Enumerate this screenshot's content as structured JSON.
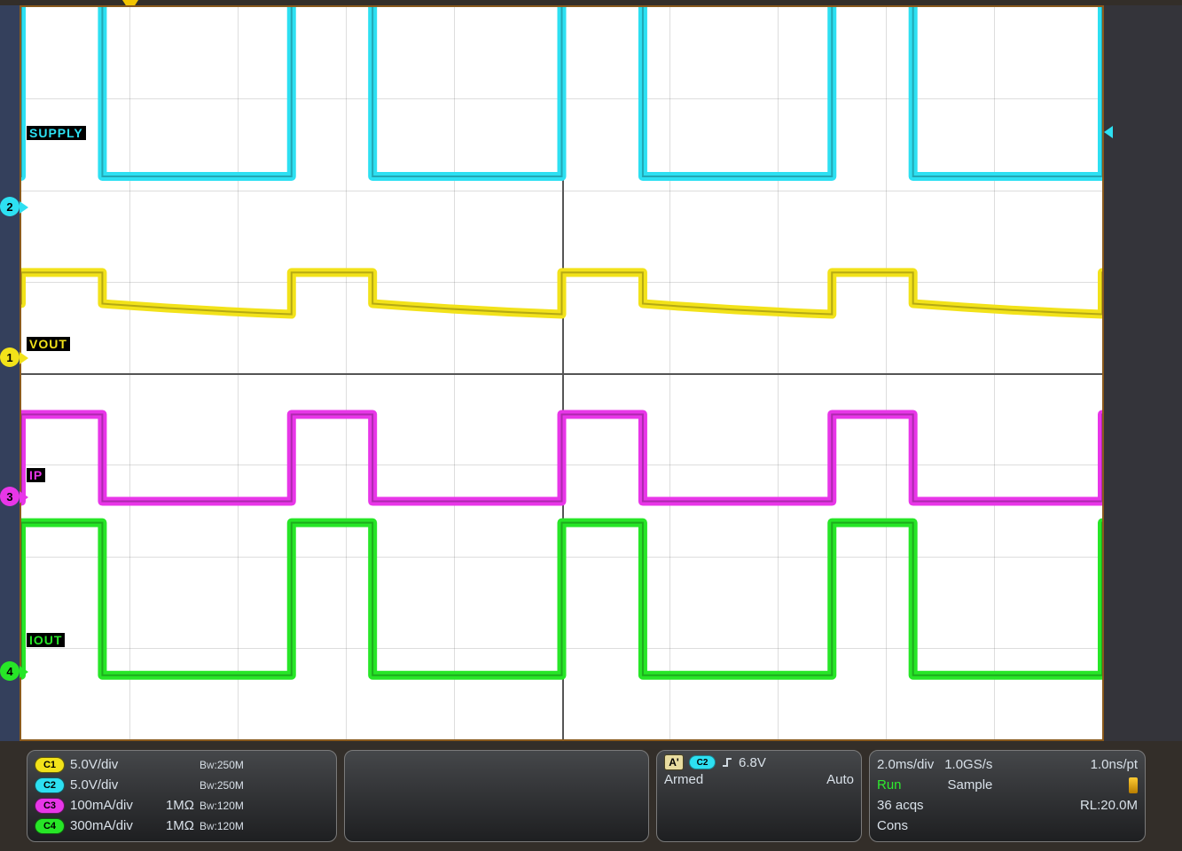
{
  "labels": {
    "ch1": "VOUT",
    "ch2": "SUPPLY",
    "ch3": "IP",
    "ch4": "IOUT"
  },
  "channels": {
    "c1": {
      "badge": "C1",
      "scale": "5.0V/div",
      "impedance": "",
      "bw": "250M",
      "color": "#f2e21a"
    },
    "c2": {
      "badge": "C2",
      "scale": "5.0V/div",
      "impedance": "",
      "bw": "250M",
      "color": "#2de0f2"
    },
    "c3": {
      "badge": "C3",
      "scale": "100mA/div",
      "impedance": "1MΩ",
      "bw": "120M",
      "color": "#e836e8"
    },
    "c4": {
      "badge": "C4",
      "scale": "300mA/div",
      "impedance": "1MΩ",
      "bw": "120M",
      "color": "#27e627"
    }
  },
  "trigger": {
    "a_badge": "A'",
    "source_badge": "C2",
    "level": "6.8V",
    "armed": "Armed",
    "mode": "Auto"
  },
  "timebase": {
    "hdiv": "2.0ms/div",
    "rate": "1.0GS/s",
    "pt": "1.0ns/pt",
    "run": "Run",
    "sample": "Sample",
    "acqs": "36 acqs",
    "rl": "RL:20.0M",
    "cons": "Cons"
  },
  "markers": {
    "ch1_num": "1",
    "ch2_num": "2",
    "ch3_num": "3",
    "ch4_num": "4"
  },
  "chart_data": {
    "type": "line",
    "title": "Oscilloscope capture",
    "x_unit": "ms",
    "timebase_ms_per_div": 2.0,
    "h_divisions": 10,
    "v_divisions": 8,
    "trigger_position_div": 1.0,
    "pulse_period_ms": 5.0,
    "pulse_high_ms": 1.5,
    "first_rising_edge_ms": 2.0,
    "series": [
      {
        "name": "SUPPLY",
        "channel": "C2",
        "color": "#2de0f2",
        "scale": "5.0V/div",
        "zero_ref_div_from_top": 2.25,
        "low_value": 2.0,
        "high_value": 12.0,
        "unit": "V",
        "waveform_hint": "square"
      },
      {
        "name": "VOUT",
        "channel": "C1",
        "color": "#f2e21a",
        "scale": "5.0V/div",
        "zero_ref_div_from_top": 3.9,
        "low_value": 3.3,
        "high_value": 5.0,
        "unit": "V",
        "waveform_hint": "square with slow decay on low segment"
      },
      {
        "name": "IP",
        "channel": "C3",
        "color": "#e836e8",
        "scale": "100mA/div",
        "zero_ref_div_from_top": 5.4,
        "low_value": 0,
        "high_value": 95,
        "unit": "mA",
        "waveform_hint": "square"
      },
      {
        "name": "IOUT",
        "channel": "C4",
        "color": "#27e627",
        "scale": "300mA/div",
        "zero_ref_div_from_top": 7.3,
        "low_value": 0,
        "high_value": 500,
        "unit": "mA",
        "waveform_hint": "square"
      }
    ]
  }
}
